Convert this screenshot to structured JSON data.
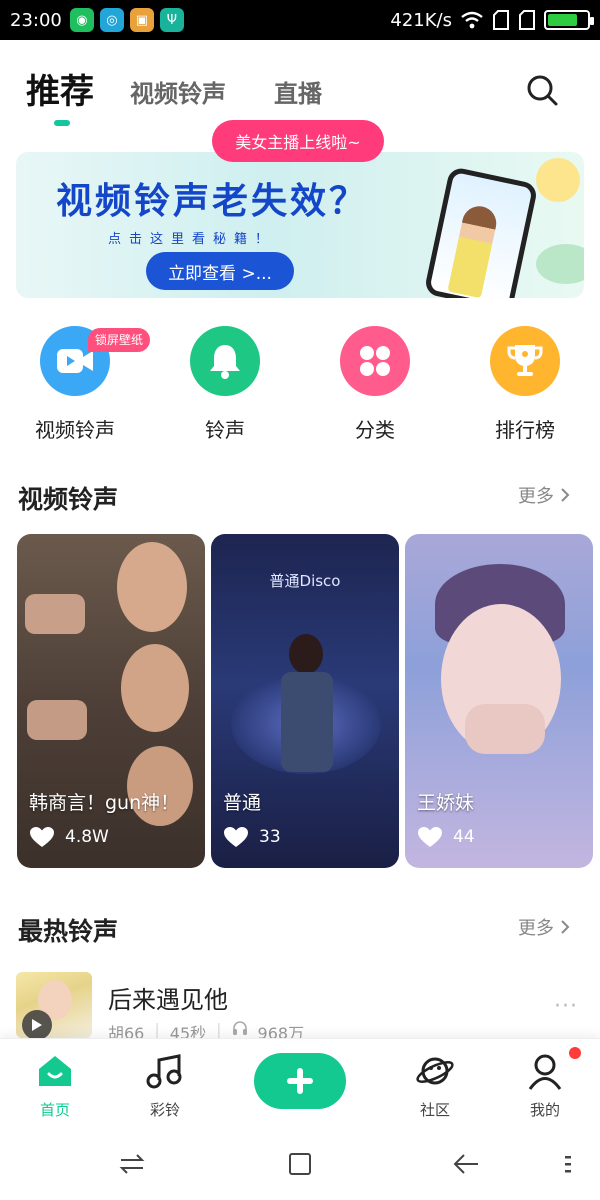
{
  "status_bar": {
    "time": "23:00",
    "net_speed": "421K/s",
    "battery_percent": 75,
    "app_icons": [
      "wechat-app-icon",
      "browser-app-icon",
      "gallery-app-icon",
      "usb-app-icon"
    ]
  },
  "top_nav": {
    "tabs": [
      {
        "label": "推荐",
        "active": true
      },
      {
        "label": "视频铃声",
        "active": false
      },
      {
        "label": "直播",
        "active": false
      }
    ],
    "accent": "#14c5a0"
  },
  "live_tip": "美女主播上线啦~",
  "banner": {
    "title": "视频铃声老失效？",
    "subtitle": "点击这里看秘籍！",
    "cta": "立即查看 >..."
  },
  "quick_actions": [
    {
      "label": "视频铃声",
      "icon": "video-icon",
      "color": "#3aa8f5",
      "badge": "锁屏壁纸"
    },
    {
      "label": "铃声",
      "icon": "bell-icon",
      "color": "#1fc784",
      "badge": ""
    },
    {
      "label": "分类",
      "icon": "category-icon",
      "color": "#ff5c8d",
      "badge": ""
    },
    {
      "label": "排行榜",
      "icon": "trophy-icon",
      "color": "#ffb52e",
      "badge": ""
    }
  ],
  "video_section": {
    "title": "视频铃声",
    "more": "更多",
    "cards": [
      {
        "title": "韩商言！gun神！",
        "likes": "4.8W"
      },
      {
        "title": "普通",
        "likes": "33",
        "overlay_title": "普通Disco"
      },
      {
        "title": "王娇妹",
        "likes": "44"
      }
    ]
  },
  "hot_section": {
    "title": "最热铃声",
    "more": "更多",
    "items": [
      {
        "title": "后来遇见他",
        "artist": "胡66",
        "duration": "45秒",
        "plays": "968万"
      }
    ]
  },
  "bottom_nav": {
    "items": [
      {
        "label": "首页",
        "icon": "home-icon",
        "active": true
      },
      {
        "label": "彩铃",
        "icon": "music-note-icon",
        "active": false
      },
      {
        "label": "社区",
        "icon": "planet-icon",
        "active": false
      },
      {
        "label": "我的",
        "icon": "profile-icon",
        "active": false
      }
    ],
    "plus_color": "#14c98f"
  }
}
